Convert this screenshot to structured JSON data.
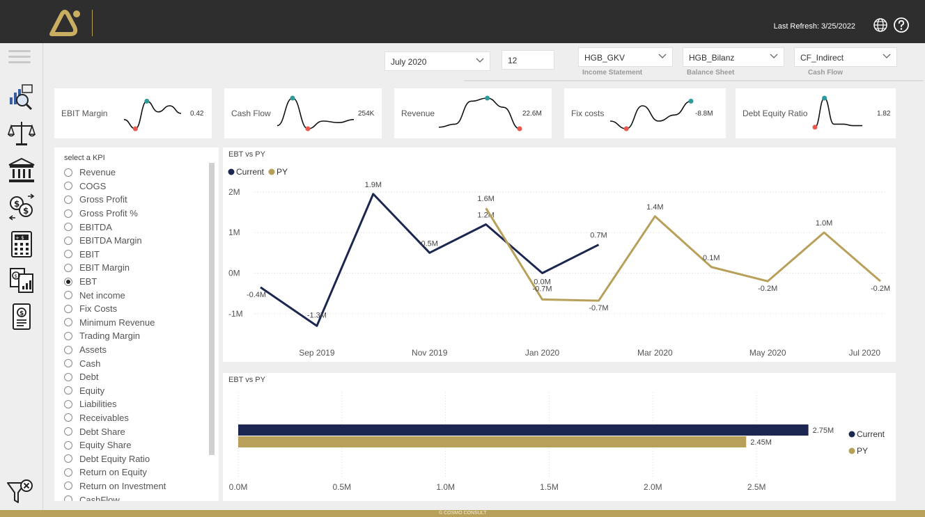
{
  "header": {
    "last_refresh": "Last Refresh: 3/25/2022"
  },
  "filters": {
    "month": "July 2020",
    "months_count": "12",
    "income_statement": {
      "value": "HGB_GKV",
      "caption": "Income Statement"
    },
    "balance_sheet": {
      "value": "HGB_Bilanz",
      "caption": "Balance Sheet"
    },
    "cash_flow": {
      "value": "CF_Indirect",
      "caption": "Cash Flow"
    }
  },
  "kpi_cards": [
    {
      "label": "EBIT Margin",
      "value": "0.42",
      "trend": [
        0.3,
        0.0,
        0.9,
        0.55,
        0.75,
        0.5
      ]
    },
    {
      "label": "Cash Flow",
      "value": "254K",
      "trend": [
        0.1,
        1.0,
        0.0,
        0.25,
        0.2,
        0.3
      ]
    },
    {
      "label": "Revenue",
      "value": "22.6M",
      "trend": [
        0.05,
        0.15,
        0.9,
        1.0,
        0.7,
        0.0
      ]
    },
    {
      "label": "Fix costs",
      "value": "-8.8M",
      "trend": [
        0.25,
        0.0,
        0.75,
        0.25,
        0.45,
        0.9
      ]
    },
    {
      "label": "Debt Equity Ratio",
      "value": "1.82",
      "trend": [
        0.05,
        1.0,
        0.15,
        0.15,
        0.1,
        0.1
      ]
    }
  ],
  "kpi_selector": {
    "title": "select a KPI",
    "selected": "EBT",
    "items": [
      "Revenue",
      "COGS",
      "Gross Profit",
      "Gross Profit %",
      "EBITDA",
      "EBITDA Margin",
      "EBIT",
      "EBIT Margin",
      "EBT",
      "Net income",
      "Fix Costs",
      "Minimum Revenue",
      "Trading Margin",
      "Assets",
      "Cash",
      "Debt",
      "Equity",
      "Liabilities",
      "Receivables",
      "Debt Share",
      "Equity Share",
      "Debt Equity Ratio",
      "Return on Equity",
      "Return on Investment",
      "CashFlow"
    ]
  },
  "colors": {
    "current": "#1b2750",
    "py": "#b8a05a",
    "accent": "#b8a05a",
    "topbar": "#2e2e2e"
  },
  "footer": {
    "text": "© COSMO CONSULT"
  },
  "chart_data": [
    {
      "type": "line",
      "title": "EBT vs PY",
      "legend": "top-left",
      "x": [
        "2019-08",
        "2019-09",
        "2019-10",
        "2019-11",
        "2019-12",
        "2020-01",
        "2020-02",
        "2020-03",
        "2020-04",
        "2020-05",
        "2020-06",
        "2020-07"
      ],
      "x_tick_labels": [
        "Sep 2019",
        "Nov 2019",
        "Jan 2020",
        "Mar 2020",
        "May 2020",
        "Jul 2020"
      ],
      "y_tick_labels": [
        "2M",
        "1M",
        "0M",
        "-1M"
      ],
      "ylim": [
        -1.5,
        2.1
      ],
      "grid": true,
      "series": [
        {
          "name": "Current",
          "values": [
            -0.35,
            -1.3,
            1.95,
            0.5,
            1.2,
            0.0,
            0.7,
            null,
            null,
            null,
            null,
            null
          ],
          "labels": [
            "-0.4M",
            "-1.3M",
            "1.9M",
            "0.5M",
            "1.2M",
            "0.0M",
            "0.7M",
            "",
            "",
            "",
            "",
            ""
          ]
        },
        {
          "name": "PY",
          "values": [
            null,
            null,
            null,
            null,
            1.6,
            -0.65,
            -0.68,
            1.4,
            0.15,
            -0.2,
            1.0,
            -0.2
          ],
          "labels": [
            "",
            "",
            "",
            "",
            "1.6M",
            "-0.7M",
            "-0.7M",
            "1.4M",
            "0.1M",
            "-0.2M",
            "1.0M",
            "-0.2M"
          ]
        }
      ]
    },
    {
      "type": "bar",
      "title": "EBT vs PY",
      "legend": "right",
      "orientation": "horizontal",
      "series": [
        {
          "name": "Current",
          "values": [
            2.75
          ],
          "label": "2.75M"
        },
        {
          "name": "PY",
          "values": [
            2.45
          ],
          "label": "2.45M"
        }
      ],
      "x_tick_labels": [
        "0.0M",
        "0.5M",
        "1.0M",
        "1.5M",
        "2.0M",
        "2.5M"
      ],
      "xlim": [
        0,
        3.0
      ],
      "grid": true
    }
  ]
}
